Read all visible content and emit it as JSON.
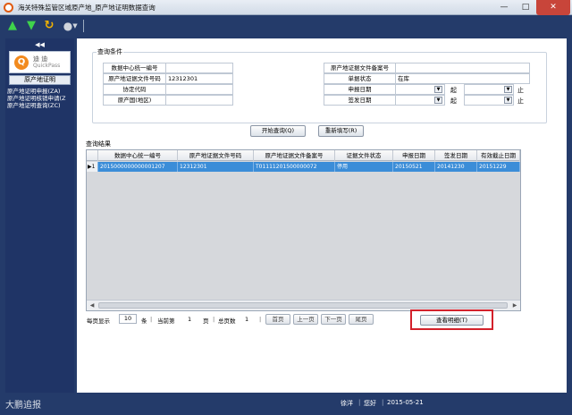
{
  "window": {
    "title": "海关特殊监管区域原产地_原产地证明数据查询",
    "min": "—",
    "max": "□",
    "close": "✕"
  },
  "toolbar": {
    "icons": [
      "arrow-up-icon",
      "arrow-down-icon",
      "refresh-icon",
      "globe-icon"
    ]
  },
  "sidebar": {
    "collapse": "◀◀",
    "logo": {
      "glyph": "Q",
      "brand": "迪 迪",
      "sub": "QuickPass"
    },
    "header": "原产地证明",
    "items": [
      "原产地证明申报(ZA)",
      "原产地证明核销申请(Z",
      "原产地证明查询(ZC)"
    ]
  },
  "query": {
    "title": "查询条件",
    "fields": {
      "center_id": {
        "label": "数据中心统一编号",
        "value": ""
      },
      "doc_no": {
        "label": "原产地证据文件号码",
        "value": "12312301"
      },
      "agreement": {
        "label": "协定代码",
        "value": ""
      },
      "origin": {
        "label": "原产国(地区)",
        "value": ""
      },
      "record_no": {
        "label": "原产地证据文件备案号",
        "value": ""
      },
      "doc_status": {
        "label": "单据状态",
        "value": "在库"
      },
      "apply_date": {
        "label": "申报日期",
        "from": "起",
        "to": "止"
      },
      "issue_date": {
        "label": "签发日期",
        "from": "起",
        "to": "止"
      }
    },
    "start_btn": "开始查询(Q)",
    "reset_btn": "重新填写(R)"
  },
  "results": {
    "title": "查询结果",
    "columns": [
      "数据中心统一编号",
      "原产地证据文件号码",
      "原产地证据文件备案号",
      "证据文件状态",
      "申报日期",
      "签发日期",
      "有效截止日期"
    ],
    "rows": [
      {
        "marker": "▶",
        "index": "1",
        "cells": [
          "2015000000000001207",
          "12312301",
          "T01111201500000072",
          "停用",
          "20150521",
          "20141230",
          "20151229"
        ]
      }
    ]
  },
  "pager": {
    "per_page_label": "每页显示",
    "per_page": "10",
    "unit_label": "条",
    "current_label": "当前第",
    "current": "1",
    "page_label": "页",
    "total_label": "总页数",
    "total": "1",
    "first": "首页",
    "prev": "上一页",
    "next": "下一页",
    "last": "尾页"
  },
  "detail_btn": "查看明细(T)",
  "status": {
    "user": "徐洋",
    "greeting": "您好",
    "date": "2015-05-21"
  },
  "watermark": "大鹏追报",
  "colors": {
    "chrome": "#243b6a",
    "selection": "#3b8dd8",
    "highlight": "#d3212b"
  }
}
